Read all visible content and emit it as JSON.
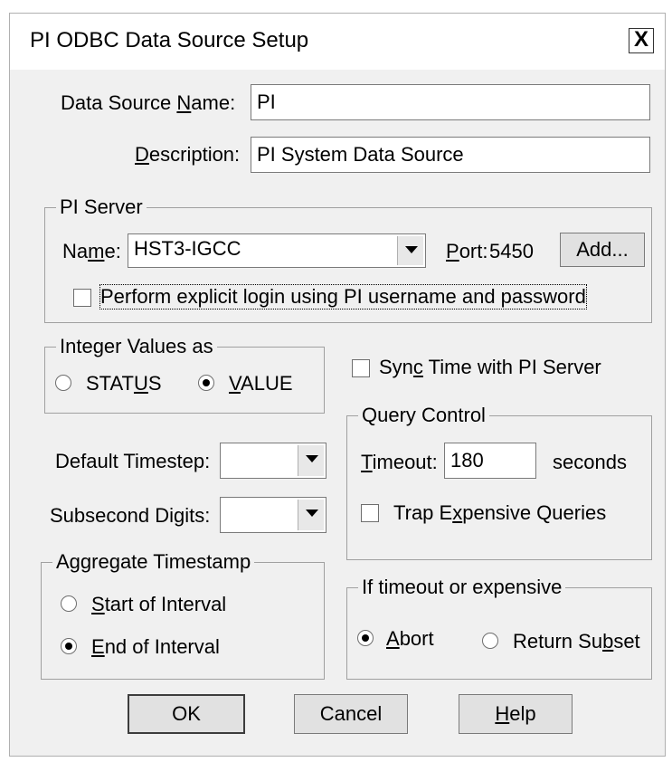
{
  "window": {
    "title": "PI ODBC Data Source Setup",
    "close_label": "X"
  },
  "dsn": {
    "name_label_pre": "Data Source ",
    "name_label_u": "N",
    "name_label_post": "ame:",
    "name_value": "PI",
    "desc_label_u": "D",
    "desc_label_post": "escription:",
    "desc_value": "PI System Data Source"
  },
  "server": {
    "legend": "PI Server",
    "name_label_pre": "Na",
    "name_label_u": "m",
    "name_label_post": "e:",
    "name_value": "HST3-IGCC",
    "port_label_u": "P",
    "port_label_post": "ort:",
    "port_value": "5450",
    "add_label": "Add...",
    "explicit_login_label": "Perform explicit login using PI username and password",
    "explicit_login_checked": false
  },
  "integer": {
    "legend": "Integer Values as",
    "status_pre": "STAT",
    "status_u": "U",
    "status_post": "S",
    "value_u": "V",
    "value_post": "ALUE",
    "selected": "VALUE"
  },
  "sync": {
    "label_pre": "Syn",
    "label_u": "c",
    "label_post": " Time with PI Server",
    "checked": false
  },
  "query": {
    "legend": "Query Control",
    "timeout_u": "T",
    "timeout_post": "imeout:",
    "timeout_value": "180",
    "seconds": "seconds",
    "trap_pre": "Trap E",
    "trap_u": "x",
    "trap_post": "pensive Queries",
    "trap_checked": false
  },
  "timestep": {
    "label": "Default Timestep:",
    "value": ""
  },
  "subsecond": {
    "label_pre": "Subsecond Di",
    "label_u": "g",
    "label_post": "its:",
    "value": ""
  },
  "aggregate": {
    "legend": "Aggregate Timestamp",
    "start_u": "S",
    "start_post": "tart of Interval",
    "end_u": "E",
    "end_post": "nd of Interval",
    "selected": "End of Interval"
  },
  "iftimeout": {
    "legend": "If timeout or expensive",
    "abort_u": "A",
    "abort_post": "bort",
    "subset_pre": "Return Su",
    "subset_u": "b",
    "subset_post": "set",
    "selected": "Abort"
  },
  "buttons": {
    "ok": "OK",
    "cancel": "Cancel",
    "help_u": "H",
    "help_post": "elp"
  }
}
